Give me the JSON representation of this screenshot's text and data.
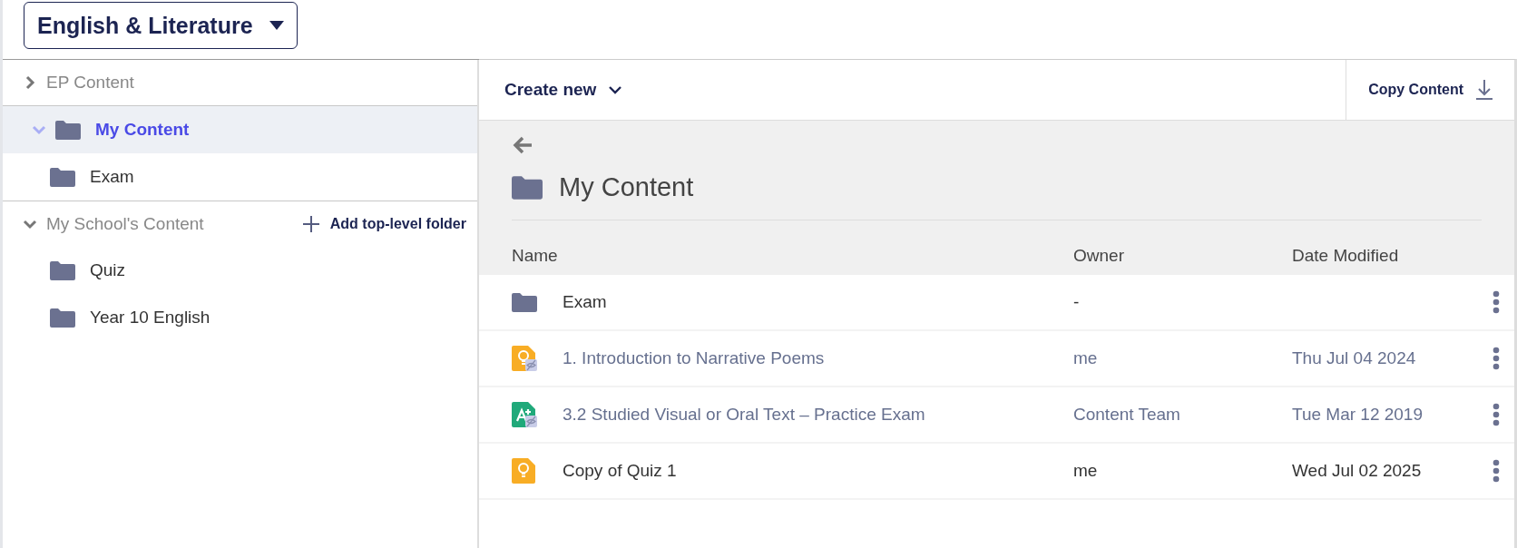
{
  "subject_selector": {
    "label": "English & Literature"
  },
  "sidebar": {
    "tree": [
      {
        "kind": "section",
        "label": "EP Content",
        "expanded": false,
        "selected": false
      },
      {
        "kind": "folder",
        "label": "My Content",
        "expanded": true,
        "selected": true,
        "children": [
          {
            "kind": "folder",
            "label": "Exam",
            "selected": false
          }
        ]
      },
      {
        "kind": "section",
        "label": "My School's Content",
        "expanded": true,
        "selected": false,
        "action": "Add top-level folder",
        "children": [
          {
            "kind": "folder",
            "label": "Quiz",
            "selected": false
          },
          {
            "kind": "folder",
            "label": "Year 10 English",
            "selected": false
          }
        ]
      }
    ]
  },
  "toolbar": {
    "create": "Create new",
    "copy": "Copy Content"
  },
  "folder": {
    "title": "My Content"
  },
  "table": {
    "columns": [
      "Name",
      "Owner",
      "Date Modified"
    ],
    "rows": [
      {
        "kind": "folder",
        "name": "Exam",
        "owner": "-",
        "date": "",
        "hidden": false
      },
      {
        "kind": "lesson",
        "name": "1. Introduction to Narrative Poems",
        "owner": "me",
        "date": "Thu Jul 04 2024",
        "hidden": true
      },
      {
        "kind": "assessment",
        "name": "3.2 Studied Visual or Oral Text – Practice Exam",
        "owner": "Content Team",
        "date": "Tue Mar 12 2019",
        "hidden": true
      },
      {
        "kind": "lesson",
        "name": "Copy of Quiz 1",
        "owner": "me",
        "date": "Wed Jul 02 2025",
        "hidden": false
      }
    ]
  }
}
